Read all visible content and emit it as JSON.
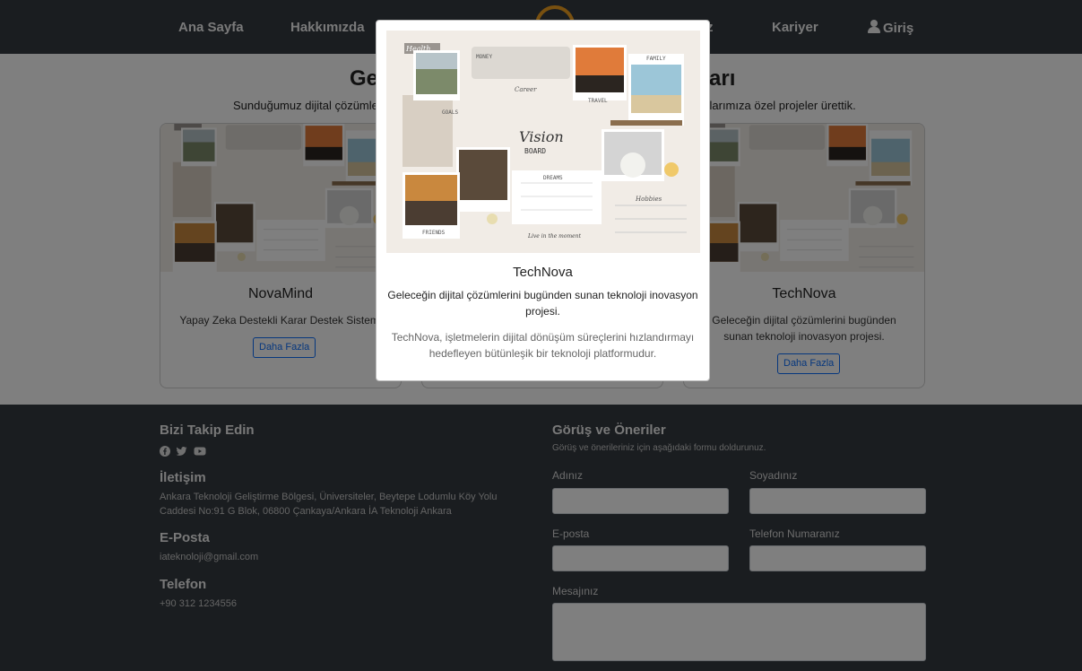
{
  "nav": {
    "items": [
      "Ana Sayfa",
      "Hakkımızda",
      "z",
      "Kariyer",
      "Giriş"
    ]
  },
  "projects": {
    "title_left": "Ge",
    "title_right": "arı",
    "subtitle_left": "Sunduğumuz dijital çözümler",
    "subtitle_right": "klarımıza özel projeler ürettik.",
    "cards": [
      {
        "title": "NovaMind",
        "description": "Yapay Zeka Destekli Karar Destek Sistemi",
        "button": "Daha Fazla"
      },
      {
        "title": "TechNova",
        "description": "Geleceğin dijital çözümlerini bugünden sunan teknoloji inovasyon projesi.",
        "button": "Daha Fazla"
      }
    ]
  },
  "vision_board": {
    "labels": [
      "Health",
      "MONEY",
      "Career",
      "GOALS",
      "FAMILY",
      "TRAVEL",
      "Vision",
      "BOARD",
      "DREAMS",
      "FRIENDS",
      "Hobbies",
      "Live in the moment"
    ]
  },
  "modal": {
    "title": "TechNova",
    "description": "Geleceğin dijital çözümlerini bugünden sunan teknoloji inovasyon projesi.",
    "long_description": "TechNova, işletmelerin dijital dönüşüm süreçlerini hızlandırmayı hedefleyen bütünleşik bir teknoloji platformudur."
  },
  "footer": {
    "follow_title": "Bizi Takip Edin",
    "social_icons": [
      "facebook-icon",
      "twitter-icon",
      "youtube-icon"
    ],
    "contact_title": "İletişim",
    "contact_address": "Ankara Teknoloji Geliştirme Bölgesi, Üniversiteler, Beytepe Lodumlu Köy Yolu Caddesi No:91 G Blok, 06800 Çankaya/Ankara İA Teknoloji Ankara",
    "email_title": "E-Posta",
    "email": "iateknoloji@gmail.com",
    "phone_title": "Telefon",
    "phone": "+90 312 1234556",
    "form_title": "Görüş ve Öneriler",
    "form_subtitle": "Görüş ve önerileriniz için aşağıdaki formu doldurunuz.",
    "labels": {
      "name": "Adınız",
      "surname": "Soyadınız",
      "email": "E-posta",
      "phone": "Telefon Numaranız",
      "message": "Mesajınız"
    }
  },
  "colors": {
    "nav_bg": "#343a40",
    "accent": "#0d6efd",
    "logo": "#f0a020"
  }
}
